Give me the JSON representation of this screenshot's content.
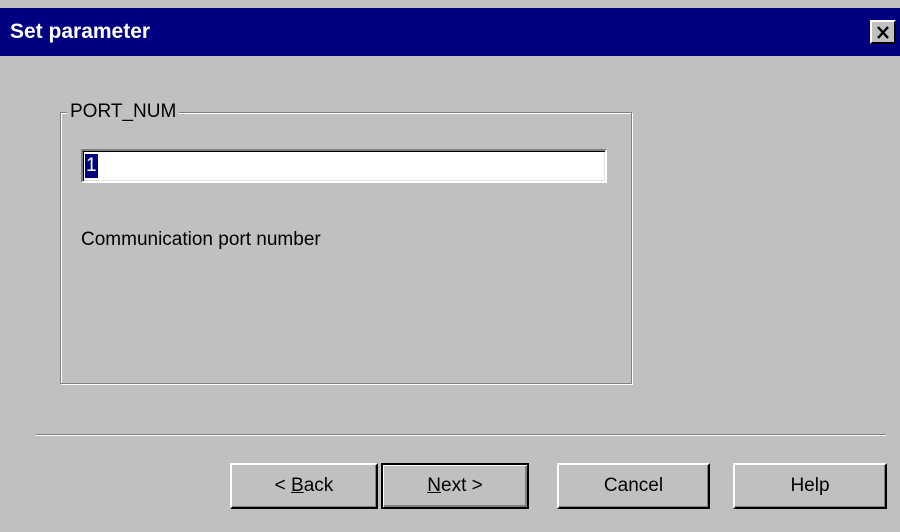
{
  "window": {
    "title": "Set parameter"
  },
  "icons": {
    "close": "close-icon"
  },
  "parameter": {
    "name": "PORT_NUM",
    "value": "1",
    "description": "Communication port number"
  },
  "buttons": {
    "back": {
      "prefix": "< ",
      "mnemonic": "B",
      "rest": "ack"
    },
    "next": {
      "mnemonic": "N",
      "rest": "ext >"
    },
    "cancel": "Cancel",
    "help": "Help"
  },
  "colors": {
    "titlebar": "#000080",
    "face": "#c0c0c0",
    "selection": "#000080"
  }
}
